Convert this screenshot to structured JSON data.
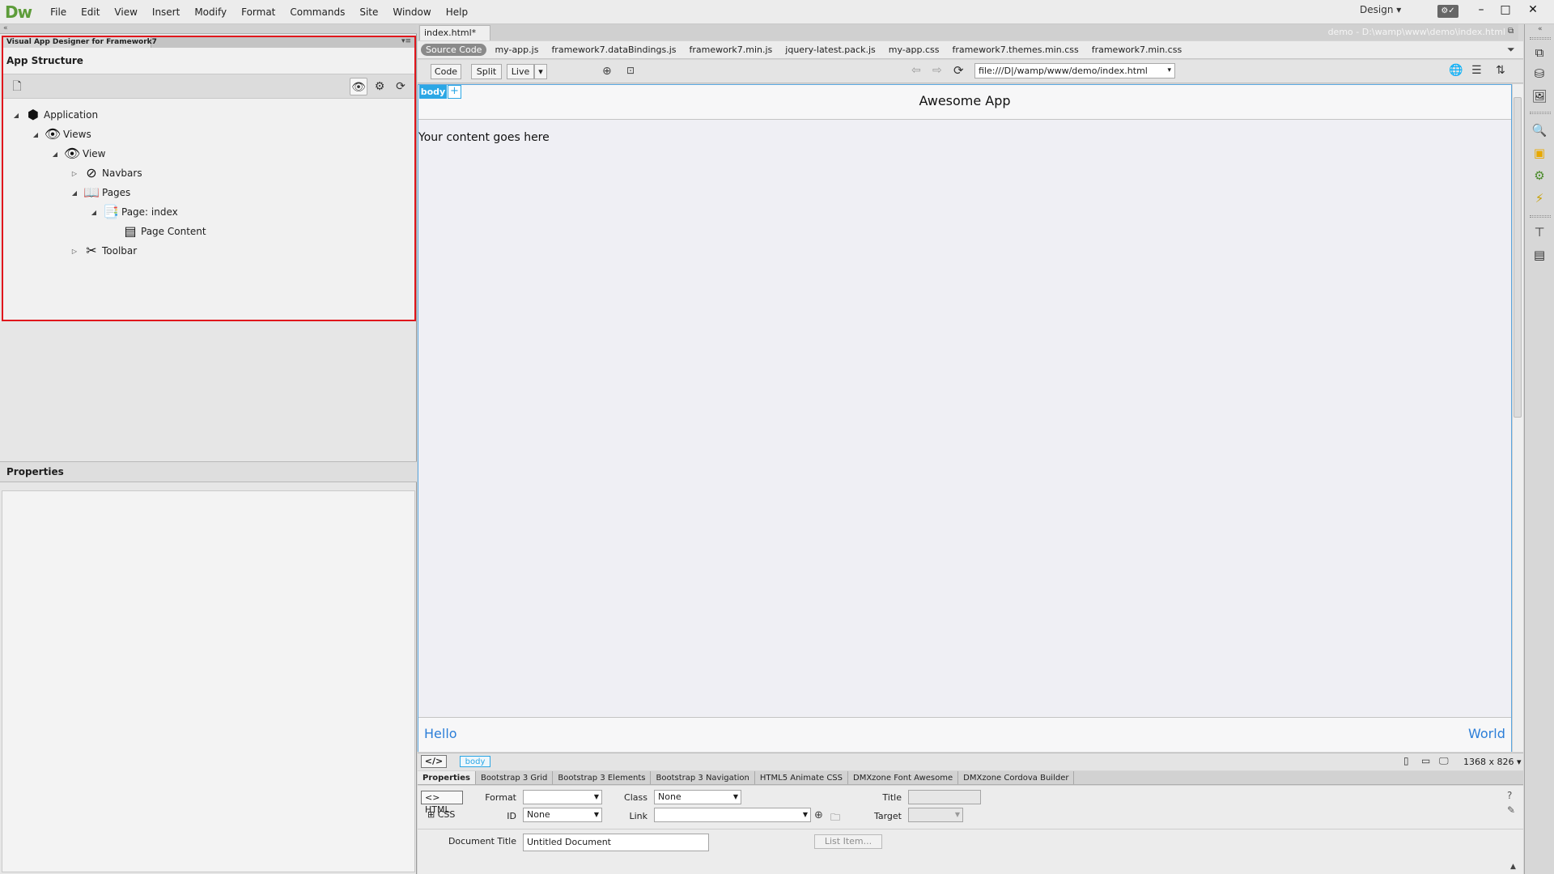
{
  "app": {
    "logo": "Dw",
    "menu": [
      "File",
      "Edit",
      "View",
      "Insert",
      "Modify",
      "Format",
      "Commands",
      "Site",
      "Window",
      "Help"
    ],
    "workspace": "Design",
    "workspace_caret": "▾",
    "collapse_glyph": "«"
  },
  "left_panel": {
    "panel_tab": "Visual App Designer for Framework7",
    "app_structure_title": "App Structure",
    "tree": [
      {
        "label": "Application",
        "icon": "package-icon",
        "expanded": "◢"
      },
      {
        "label": "Views",
        "icon": "eye-icon",
        "expanded": "◢"
      },
      {
        "label": "View",
        "icon": "eye-icon",
        "expanded": "◢"
      },
      {
        "label": "Navbars",
        "icon": "compass-icon",
        "expanded": "▷"
      },
      {
        "label": "Pages",
        "icon": "book-icon",
        "expanded": "◢"
      },
      {
        "label": "Page: index",
        "icon": "page-book-icon",
        "expanded": "◢"
      },
      {
        "label": "Page Content",
        "icon": "page-content-icon",
        "expanded": ""
      },
      {
        "label": "Toolbar",
        "icon": "tools-icon",
        "expanded": "▷"
      }
    ],
    "properties_title": "Properties"
  },
  "document": {
    "tab_label": "index.html*",
    "tab_close": "×",
    "path": "demo - D:\\wamp\\www\\demo\\index.html",
    "related_files": [
      "Source Code",
      "my-app.js",
      "framework7.dataBindings.js",
      "framework7.min.js",
      "jquery-latest.pack.js",
      "my-app.css",
      "framework7.themes.min.css",
      "framework7.min.css"
    ],
    "view_buttons": {
      "code": "Code",
      "split": "Split",
      "live": "Live",
      "live_caret": "▾"
    },
    "address": "file:///D|/wamp/www/demo/index.html",
    "address_caret": "▾"
  },
  "canvas": {
    "body_tag": "body",
    "body_plus": "+",
    "navbar_title": "Awesome App",
    "content_text": "Your content goes here",
    "toolbar_left": "Hello",
    "toolbar_right": "World"
  },
  "tag_selector": {
    "code_tag": "</>",
    "crumb": "body",
    "viewport": "1368 x 826 ▾"
  },
  "property_inspector": {
    "tabs": [
      "Properties",
      "Bootstrap 3 Grid",
      "Bootstrap 3 Elements",
      "Bootstrap 3 Navigation",
      "HTML5 Animate CSS",
      "DMXzone Font Awesome",
      "DMXzone Cordova Builder"
    ],
    "html_mode": "<> HTML",
    "css_mode": "CSS",
    "format_label": "Format",
    "format_value": "",
    "class_label": "Class",
    "class_value": "None",
    "title_label": "Title",
    "title_value": "",
    "id_label": "ID",
    "id_value": "None",
    "link_label": "Link",
    "link_value": "",
    "target_label": "Target",
    "target_value": "",
    "doc_title_label": "Document Title",
    "doc_title_value": "Untitled Document",
    "list_item_button": "List Item..."
  },
  "colors": {
    "accent": "#2ba7e5",
    "highlight_frame": "#e0161c",
    "link_blue": "#2b7ed8",
    "logo_green": "#5d9c3a"
  }
}
